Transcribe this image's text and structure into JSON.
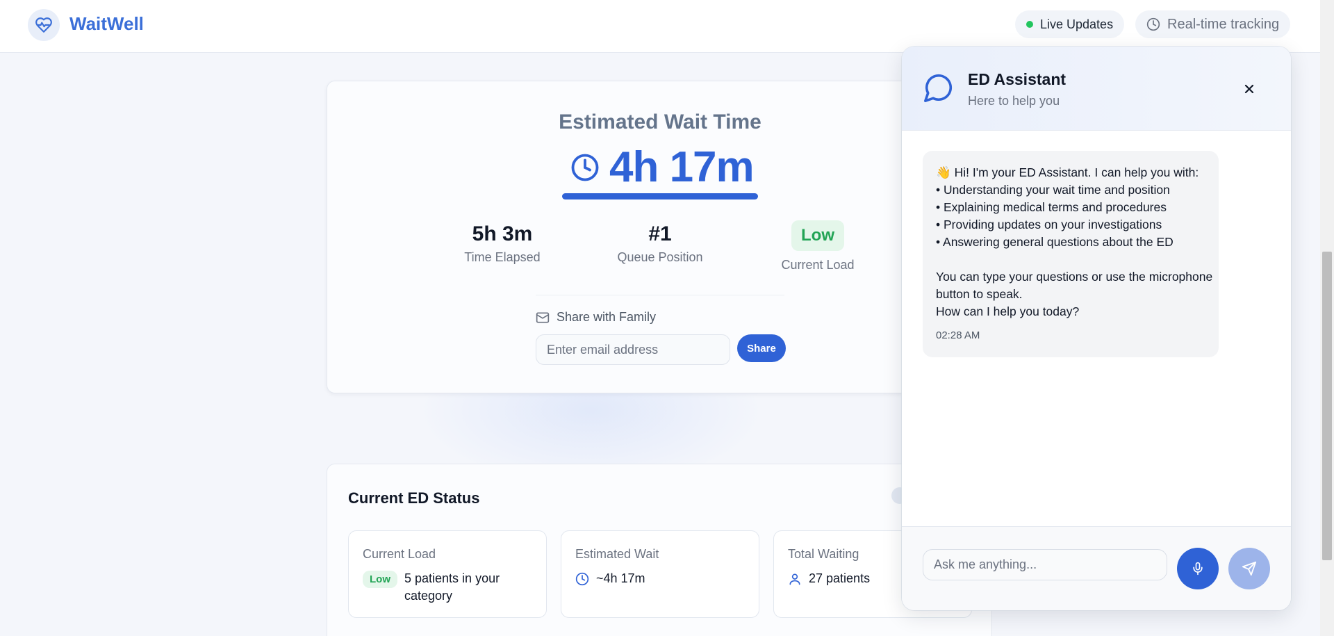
{
  "header": {
    "brand": "WaitWell",
    "live_updates": "Live Updates",
    "tracking": "Real-time tracking"
  },
  "wait": {
    "title": "Estimated Wait Time",
    "value": "4h 17m",
    "stats": [
      {
        "value": "5h 3m",
        "label": "Time Elapsed"
      },
      {
        "value": "#1",
        "label": "Queue Position"
      },
      {
        "value": "Low",
        "label": "Current Load"
      }
    ],
    "share_label": "Share with Family",
    "email_placeholder": "Enter email address",
    "share_button": "Share"
  },
  "status": {
    "title": "Current ED Status",
    "cards": [
      {
        "label": "Current Load",
        "badge": "Low",
        "text": "5 patients in your category"
      },
      {
        "label": "Estimated Wait",
        "text": "~4h 17m"
      },
      {
        "label": "Total Waiting",
        "text": "27 patients"
      }
    ]
  },
  "chat": {
    "title": "ED Assistant",
    "subtitle": "Here to help you",
    "message": "👋 Hi! I'm your ED Assistant. I can help you with:\n• Understanding your wait time and position\n• Explaining medical terms and procedures\n• Providing updates on your investigations\n• Answering general questions about the ED\n\nYou can type your questions or use the microphone button to speak.\nHow can I help you today?",
    "time": "02:28 AM",
    "input_placeholder": "Ask me anything..."
  },
  "colors": {
    "accent": "#2f62d6",
    "success": "#22c55e",
    "badge_bg": "#e4f6ea"
  }
}
